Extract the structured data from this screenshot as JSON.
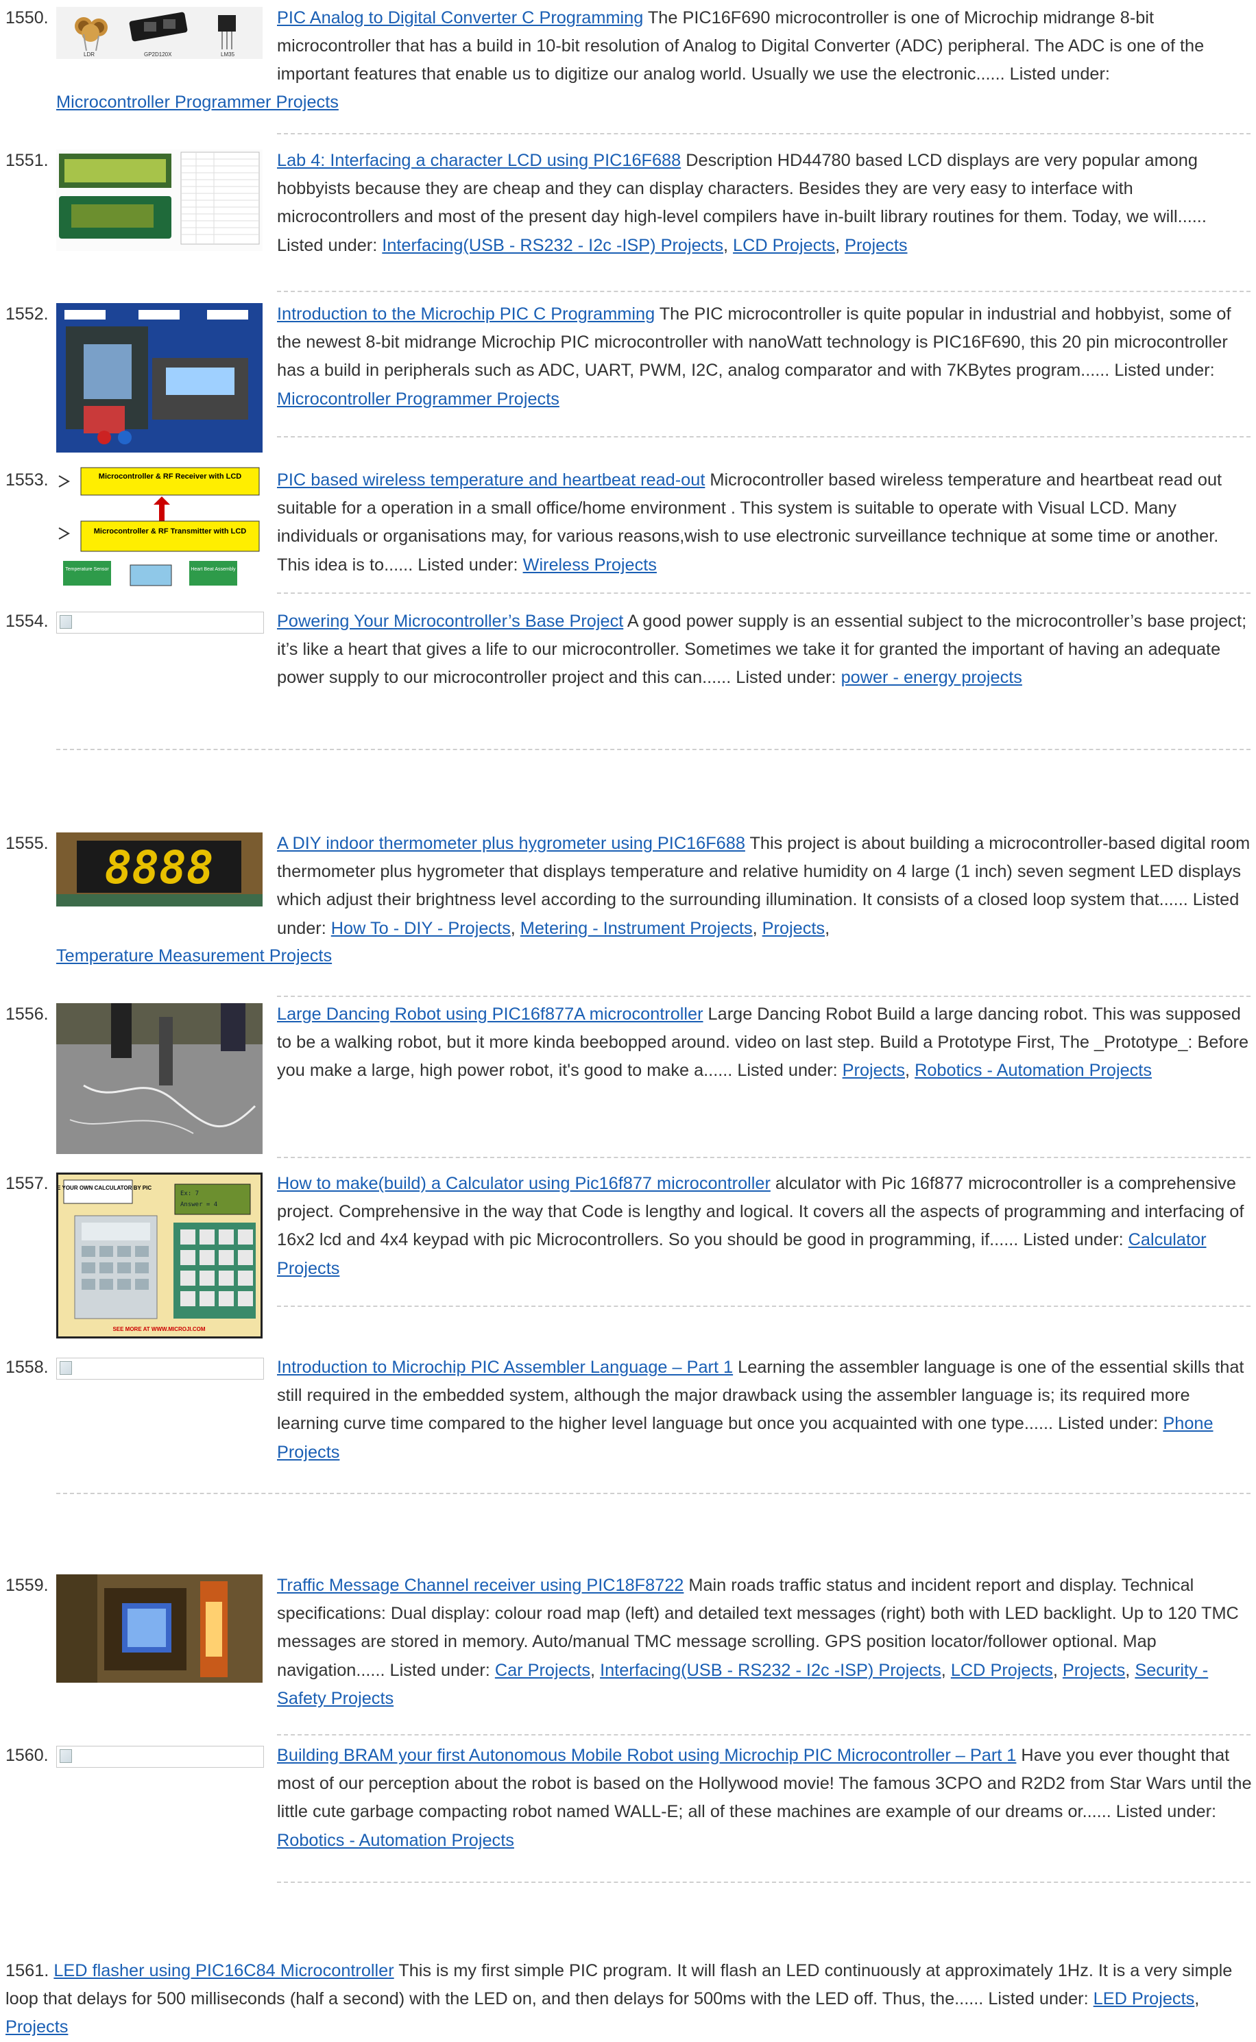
{
  "entries": [
    {
      "num": "1550.",
      "title": "PIC Analog to Digital Converter C Programming",
      "desc": " The PIC16F690 microcontroller is one of Microchip midrange 8-bit microcontroller that has a build in 10-bit resolution of Analog to Digital Converter (ADC) peripheral. The ADC is one of the important features that enable us to digitize our analog world. Usually we use the electronic...... Listed under: ",
      "categories": [
        "Microcontroller Programmer Projects"
      ],
      "thumb_labels": [
        "LDR",
        "GP2D120X",
        "LM35"
      ]
    },
    {
      "num": "1551.",
      "title": "Lab 4: Interfacing a character LCD using PIC16F688",
      "desc": " Description HD44780 based LCD displays are very popular among hobbyists because they are cheap and they can display characters. Besides they are very easy to interface with microcontrollers and most of the present day high-level compilers have in-built library routines for them. Today, we will...... Listed under: ",
      "categories": [
        "Interfacing(USB - RS232 - I2c -ISP) Projects",
        "LCD Projects",
        "Projects"
      ]
    },
    {
      "num": "1552.",
      "title": "Introduction to the Microchip PIC C Programming",
      "desc": " The PIC microcontroller is quite popular in industrial and hobbyist, some of the newest 8-bit midrange Microchip PIC microcontroller with nanoWatt technology is PIC16F690, this 20 pin microcontroller has a build in peripherals such as ADC, UART, PWM, I2C, analog comparator and with 7KBytes program...... Listed under: ",
      "categories": [
        "Microcontroller Programmer Projects"
      ]
    },
    {
      "num": "1553.",
      "title": "PIC based wireless temperature and heartbeat read-out",
      "desc": " Microcontroller based wireless temperature and heartbeat read out suitable for a operation in a small office/home environment . This system is suitable to operate with Visual LCD. Many individuals or organisations may, for various reasons,wish to use electronic surveillance technique at some time or another. This idea is to...... Listed under: ",
      "categories": [
        "Wireless Projects"
      ],
      "thumb_labels": [
        "Microcontroller & RF Receiver with LCD",
        "Microcontroller & RF Transmitter with LCD",
        "Temperature Sensor",
        "Heart Beat Assembly"
      ]
    },
    {
      "num": "1554.",
      "title": "Powering Your Microcontroller’s Base Project",
      "desc": " A good power supply is an essential subject to the microcontroller’s base project; it’s like a heart that gives a life to our microcontroller. Sometimes we take it for granted the important of having an adequate power supply to our microcontroller project and this can...... Listed under: ",
      "categories": [
        "power - energy projects"
      ]
    },
    {
      "num": "1555.",
      "title": "A DIY indoor thermometer plus hygrometer using PIC16F688",
      "desc": " This project is about building a microcontroller-based digital room thermometer plus hygrometer that displays temperature and relative humidity on 4 large (1 inch) seven segment LED displays which adjust their brightness level according to the surrounding illumination. It consists of a closed loop system that...... Listed under: ",
      "categories": [
        "How To - DIY - Projects",
        "Metering - Instrument Projects",
        "Projects",
        "Temperature Measurement Projects"
      ]
    },
    {
      "num": "1556.",
      "title": "Large Dancing Robot using PIC16f877A microcontroller",
      "desc": " Large Dancing Robot Build a large dancing robot. This was supposed to be a walking robot, but it more kinda beebopped around. video on last step. Build a Prototype First, The _Prototype_: Before you make a large, high power robot, it's good to make a...... Listed under: ",
      "categories": [
        "Projects",
        "Robotics - Automation Projects"
      ]
    },
    {
      "num": "1557.",
      "title": "How to make(build) a Calculator using Pic16f877 microcontroller",
      "desc": " alculator with Pic 16f877 microcontroller is a comprehensive project. Comprehensive in the way that Code is lengthy and logical. It covers all the aspects of programming and interfacing of 16x2 lcd and 4x4 keypad with pic Microcontrollers. So you should be good in programming, if...... Listed under: ",
      "categories": [
        "Calculator Projects"
      ],
      "thumb_labels": [
        "MAKE YOUR OWN CALCULATOR BY PIC",
        "SEE MORE AT WWW.MICROJI.COM"
      ]
    },
    {
      "num": "1558.",
      "title": "Introduction to Microchip PIC Assembler Language – Part 1",
      "desc": " Learning the assembler language is one of the essential skills that still required in the embedded system, although the major drawback using the assembler language is; its required more learning curve time compared to the higher level language but once you acquainted with one type...... Listed under: ",
      "categories": [
        "Phone Projects"
      ]
    },
    {
      "num": "1559.",
      "title": "Traffic Message Channel receiver using PIC18F8722",
      "desc": " Main roads traffic status and incident report and display. Technical specifications: Dual display: colour road map (left) and detailed text messages (right) both with LED backlight. Up to 120 TMC messages are stored in memory. Auto/manual TMC message scrolling. GPS position locator/follower optional. Map navigation...... Listed under: ",
      "categories": [
        "Car Projects",
        "Interfacing(USB - RS232 - I2c -ISP) Projects",
        "LCD Projects",
        "Projects",
        "Security - Safety Projects"
      ]
    },
    {
      "num": "1560.",
      "title": "Building BRAM your first Autonomous Mobile Robot using Microchip PIC Microcontroller – Part 1",
      "desc": " Have you ever thought that most of our perception about the robot is based on the Hollywood movie! The famous 3CPO and R2D2 from Star Wars until the little cute garbage compacting robot named WALL-E; all of these machines are example of our dreams or...... Listed under: ",
      "categories": [
        "Robotics - Automation Projects"
      ]
    },
    {
      "num": "1561.",
      "title": "LED flasher using PIC16C84 Microcontroller",
      "desc": " This is my first simple PIC program. It will flash an LED continuously at approximately 1Hz. It is a very simple loop that delays for 500 milliseconds (half a second) with the LED on, and then delays for 500ms with the LED off. Thus, the...... Listed under: ",
      "categories": [
        "LED Projects",
        "Projects"
      ]
    }
  ],
  "lcd_1557": [
    "Ex: 7",
    "Answer = 4"
  ],
  "seg_1555": "8888",
  "colors": {
    "link": "#1a5fb4",
    "text": "#333333",
    "separator": "#cfcfcf"
  }
}
